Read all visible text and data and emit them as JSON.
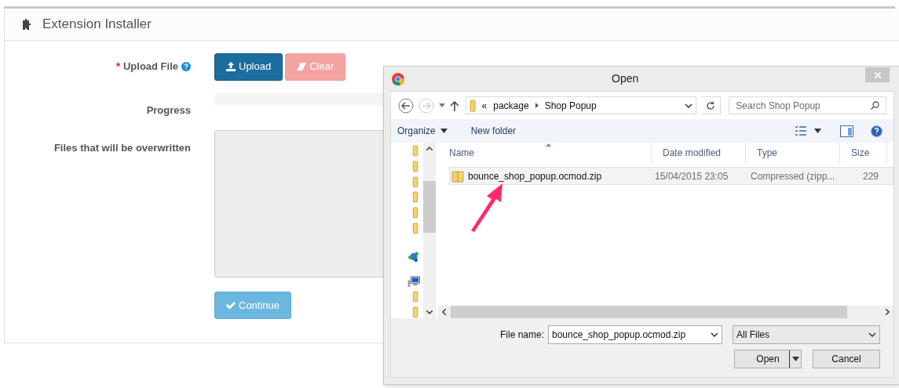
{
  "panel": {
    "title": "Extension Installer"
  },
  "form": {
    "upload_label": "Upload File",
    "required_mark": "*",
    "buttons": [
      {
        "label": "Upload",
        "kind": "upload",
        "disabled": false
      },
      {
        "label": "Clear",
        "kind": "clear",
        "disabled": true
      }
    ],
    "progress_label": "Progress",
    "progress": {
      "level": 0
    },
    "files_label": "Files that will be overwritten",
    "continue": {
      "label": "Continue",
      "disabled": true
    }
  },
  "dialog": {
    "title": "Open",
    "path": [
      "«",
      "package",
      "Shop Popup"
    ],
    "search": {
      "placeholder": "Search Shop Popup"
    },
    "toolbar": [
      "Organize",
      "New folder"
    ],
    "columns": [
      "Name",
      "Date modified",
      "Type",
      "Size"
    ],
    "rows": [
      {
        "name": "bounce_shop_popup.ocmod.zip",
        "date": "15/04/2015 23:05",
        "type": "Compressed (zipp...",
        "size": "229",
        "selected": true
      }
    ],
    "file_name_label": "File name:",
    "file_name": "bounce_shop_popup.ocmod.zip",
    "filter": "All Files",
    "buttons": [
      "Open",
      "Cancel"
    ]
  }
}
